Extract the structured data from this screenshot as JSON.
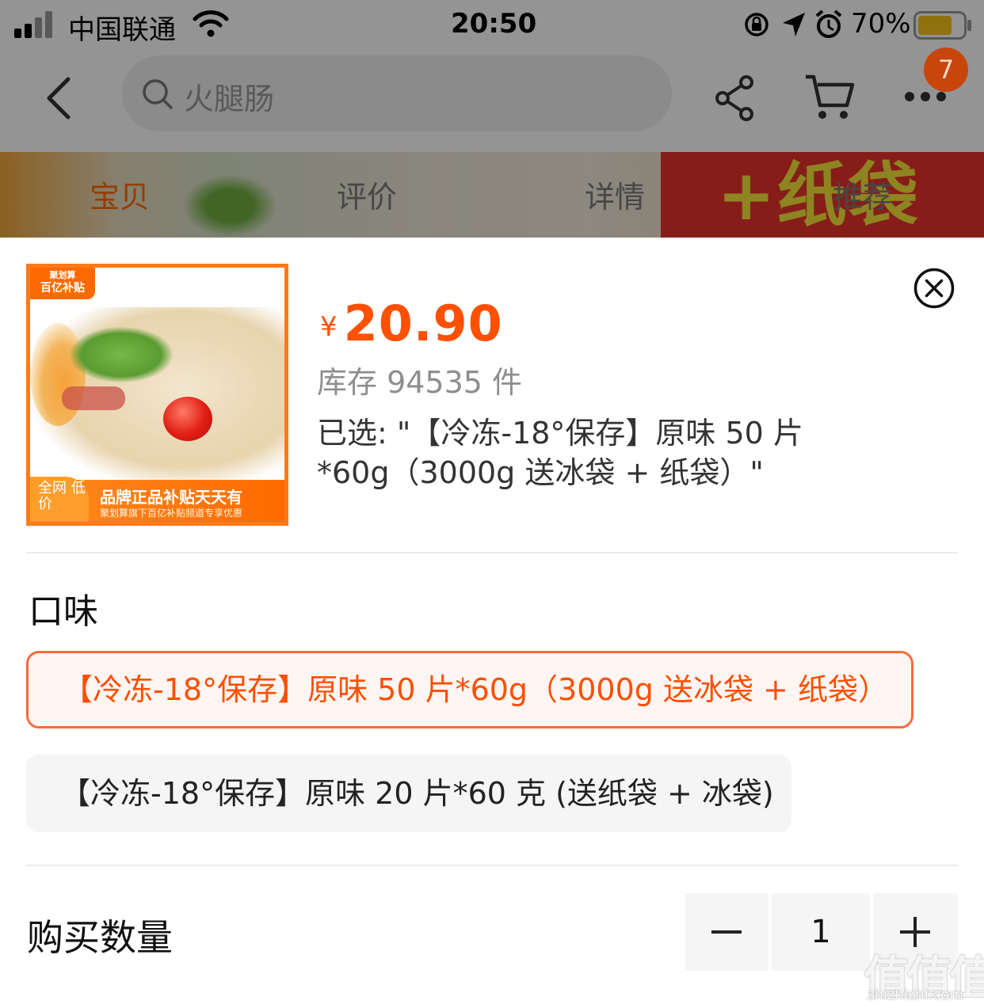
{
  "status_bar": {
    "carrier": "中国联通",
    "time": "20:50",
    "battery": "70%"
  },
  "nav": {
    "search_placeholder": "火腿肠",
    "cart_badge": "7"
  },
  "background_tabs": [
    "宝贝",
    "评价",
    "详情",
    "推荐"
  ],
  "banner_text": "+纸袋",
  "product": {
    "image_badge_top_l1": "聚划算",
    "image_badge_top_l2": "百亿补贴",
    "image_corner": "全网 低价",
    "image_banner_main": "品牌正品补贴天天有",
    "image_banner_sub": "聚划算旗下百亿补贴频道专享优惠",
    "currency": "¥",
    "price": "20.90",
    "stock": "库存 94535 件",
    "selected": "已选: \"【冷冻-18°保存】原味 50 片 *60g（3000g 送冰袋 + 纸袋）\""
  },
  "flavor": {
    "title": "口味",
    "options": [
      {
        "label": "【冷冻-18°保存】原味 50 片*60g（3000g 送冰袋 + 纸袋）",
        "selected": true
      },
      {
        "label": "【冷冻-18°保存】原味 20 片*60 克 (送纸袋 + 冰袋)",
        "selected": false
      }
    ]
  },
  "quantity": {
    "title": "购买数量",
    "value": "1"
  },
  "watermark": {
    "glyphs": "值值值",
    "domain": "zhizhizhi.com"
  },
  "colors": {
    "accent": "#ff5000",
    "thumb_border": "#ff7a18",
    "selected_border": "#ff6a3d",
    "chip_bg": "#f5f5f5"
  }
}
